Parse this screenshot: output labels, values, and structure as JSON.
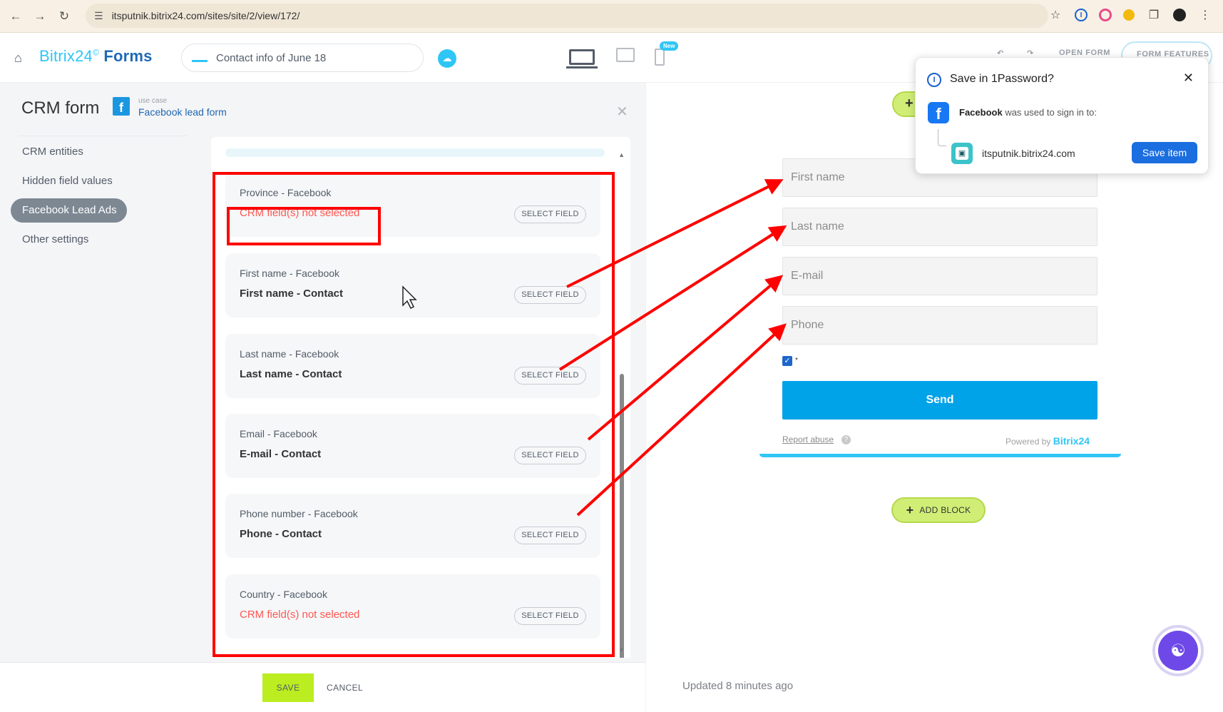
{
  "browser": {
    "url": "itsputnik.bitrix24.com/sites/site/2/view/172/"
  },
  "header": {
    "brand_name": "Bitrix24",
    "brand_mark": "©",
    "brand_suffix": "Forms",
    "form_name": "Contact info of June 18",
    "new_badge": "New",
    "open_form": "OPEN FORM",
    "form_features": "FORM FEATURES"
  },
  "panel": {
    "title": "CRM form",
    "use_case_label": "use case",
    "use_case_value": "Facebook lead form",
    "nav": [
      {
        "label": "CRM entities"
      },
      {
        "label": "Hidden field values"
      },
      {
        "label": "Facebook Lead Ads"
      },
      {
        "label": "Other settings"
      }
    ],
    "fields": [
      {
        "source": "Province - Facebook",
        "target": "CRM field(s) not selected",
        "button": "SELECT FIELD"
      },
      {
        "source": "First name - Facebook",
        "target": "First name - Contact",
        "button": "SELECT FIELD"
      },
      {
        "source": "Last name - Facebook",
        "target": "Last name - Contact",
        "button": "SELECT FIELD"
      },
      {
        "source": "Email - Facebook",
        "target": "E-mail - Contact",
        "button": "SELECT FIELD"
      },
      {
        "source": "Phone number - Facebook",
        "target": "Phone - Contact",
        "button": "SELECT FIELD"
      },
      {
        "source": "Country - Facebook",
        "target": "CRM field(s) not selected",
        "button": "SELECT FIELD"
      }
    ],
    "save": "SAVE",
    "cancel": "CANCEL"
  },
  "preview": {
    "inputs": [
      {
        "placeholder": "First name"
      },
      {
        "placeholder": "Last name"
      },
      {
        "placeholder": "E-mail"
      },
      {
        "placeholder": "Phone"
      }
    ],
    "checkbox_mark": "*",
    "send": "Send",
    "report_abuse": "Report abuse",
    "powered_by": "Powered by",
    "powered_brand": "Bitrix24",
    "add_block": "ADD BLOCK",
    "updated": "Updated 8 minutes ago"
  },
  "password_popup": {
    "title": "Save in 1Password?",
    "provider": "Facebook",
    "used_text": "was used to sign in to:",
    "site": "itsputnik.bitrix24.com",
    "save_button": "Save item"
  },
  "colors": {
    "accent": "#2fc6f6",
    "error": "#ff5752",
    "send_button": "#00a2e8",
    "save_button": "#bbed21",
    "annotation": "#ff0000"
  }
}
